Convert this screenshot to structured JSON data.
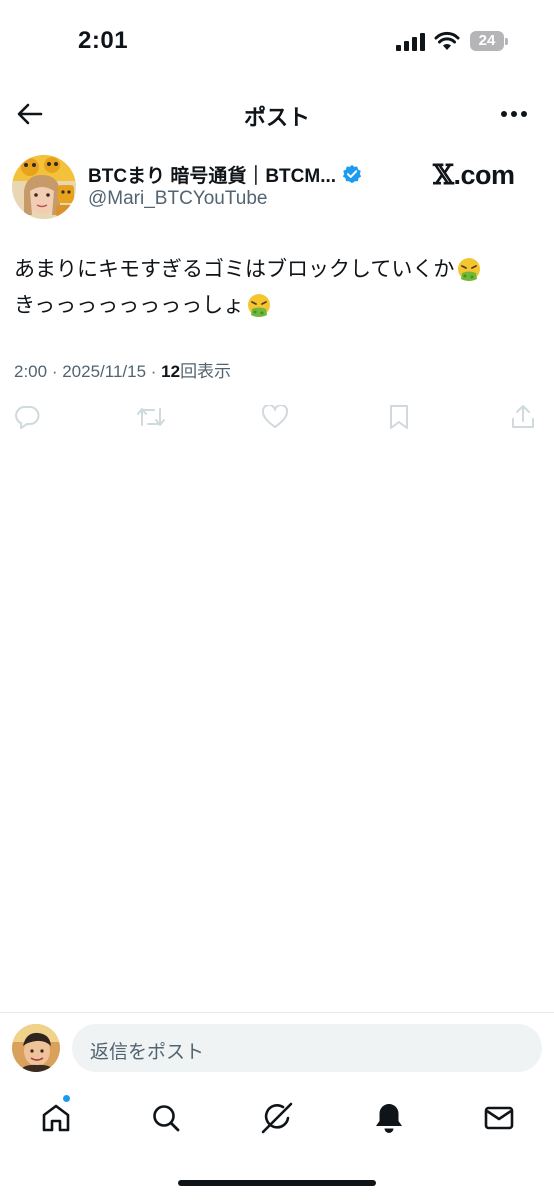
{
  "status_bar": {
    "time": "2:01",
    "battery_level": "24"
  },
  "header": {
    "title": "ポスト"
  },
  "author": {
    "display_name": "BTCまり 暗号通貨｜BTCM...",
    "handle": "@Mari_BTCYouTube",
    "watermark_x": "𝕏",
    "watermark_domain": ".com"
  },
  "tweet": {
    "line1": "あまりにキモすぎるゴミはブロックしていくか",
    "line2": "きっっっっっっっっしょ",
    "time": "2:00",
    "separator": " · ",
    "date": "2025/11/15",
    "views_count": "12",
    "views_label": "回表示"
  },
  "reply": {
    "placeholder": "返信をポスト"
  },
  "icons": {
    "back": "arrow-left-icon",
    "more": "more-horizontal-icon",
    "verified": "verified-badge-icon",
    "reply": "reply-icon",
    "repost": "repost-icon",
    "like": "heart-icon",
    "bookmark": "bookmark-icon",
    "share": "share-icon",
    "home": "home-icon",
    "search": "search-icon",
    "grok": "grok-icon",
    "notifications": "bell-icon",
    "messages": "envelope-icon",
    "emoji": "vomiting-face-emoji"
  },
  "colors": {
    "text": "#0f1419",
    "secondary": "#536471",
    "accent": "#1d9bf0",
    "action_icons": "#cfd9de"
  }
}
